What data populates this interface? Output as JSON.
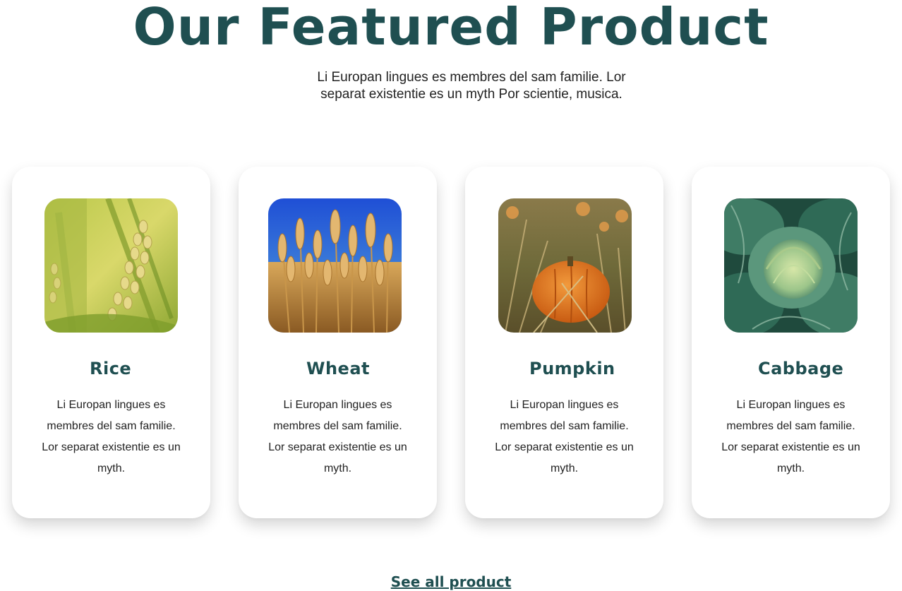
{
  "section": {
    "title": "Our Featured Product",
    "subtitle": "Li Europan lingues es membres del sam familie. Lor separat existentie es un myth Por scientie, musica."
  },
  "products": [
    {
      "name": "Rice",
      "description": "Li Europan lingues es membres del sam familie. Lor separat existentie es un myth.",
      "image": "rice-photo"
    },
    {
      "name": "Wheat",
      "description": "Li Europan lingues es membres del sam familie. Lor separat existentie es un myth.",
      "image": "wheat-photo"
    },
    {
      "name": "Pumpkin",
      "description": "Li Europan lingues es membres del sam familie. Lor separat existentie es un myth.",
      "image": "pumpkin-photo"
    },
    {
      "name": "Cabbage",
      "description": "Li Europan lingues es membres del sam familie. Lor separat existentie es un myth.",
      "image": "cabbage-photo"
    }
  ],
  "footer": {
    "see_all_label": "See all product"
  },
  "colors": {
    "accent": "#1f4f51",
    "text": "#222222",
    "background": "#ffffff"
  }
}
